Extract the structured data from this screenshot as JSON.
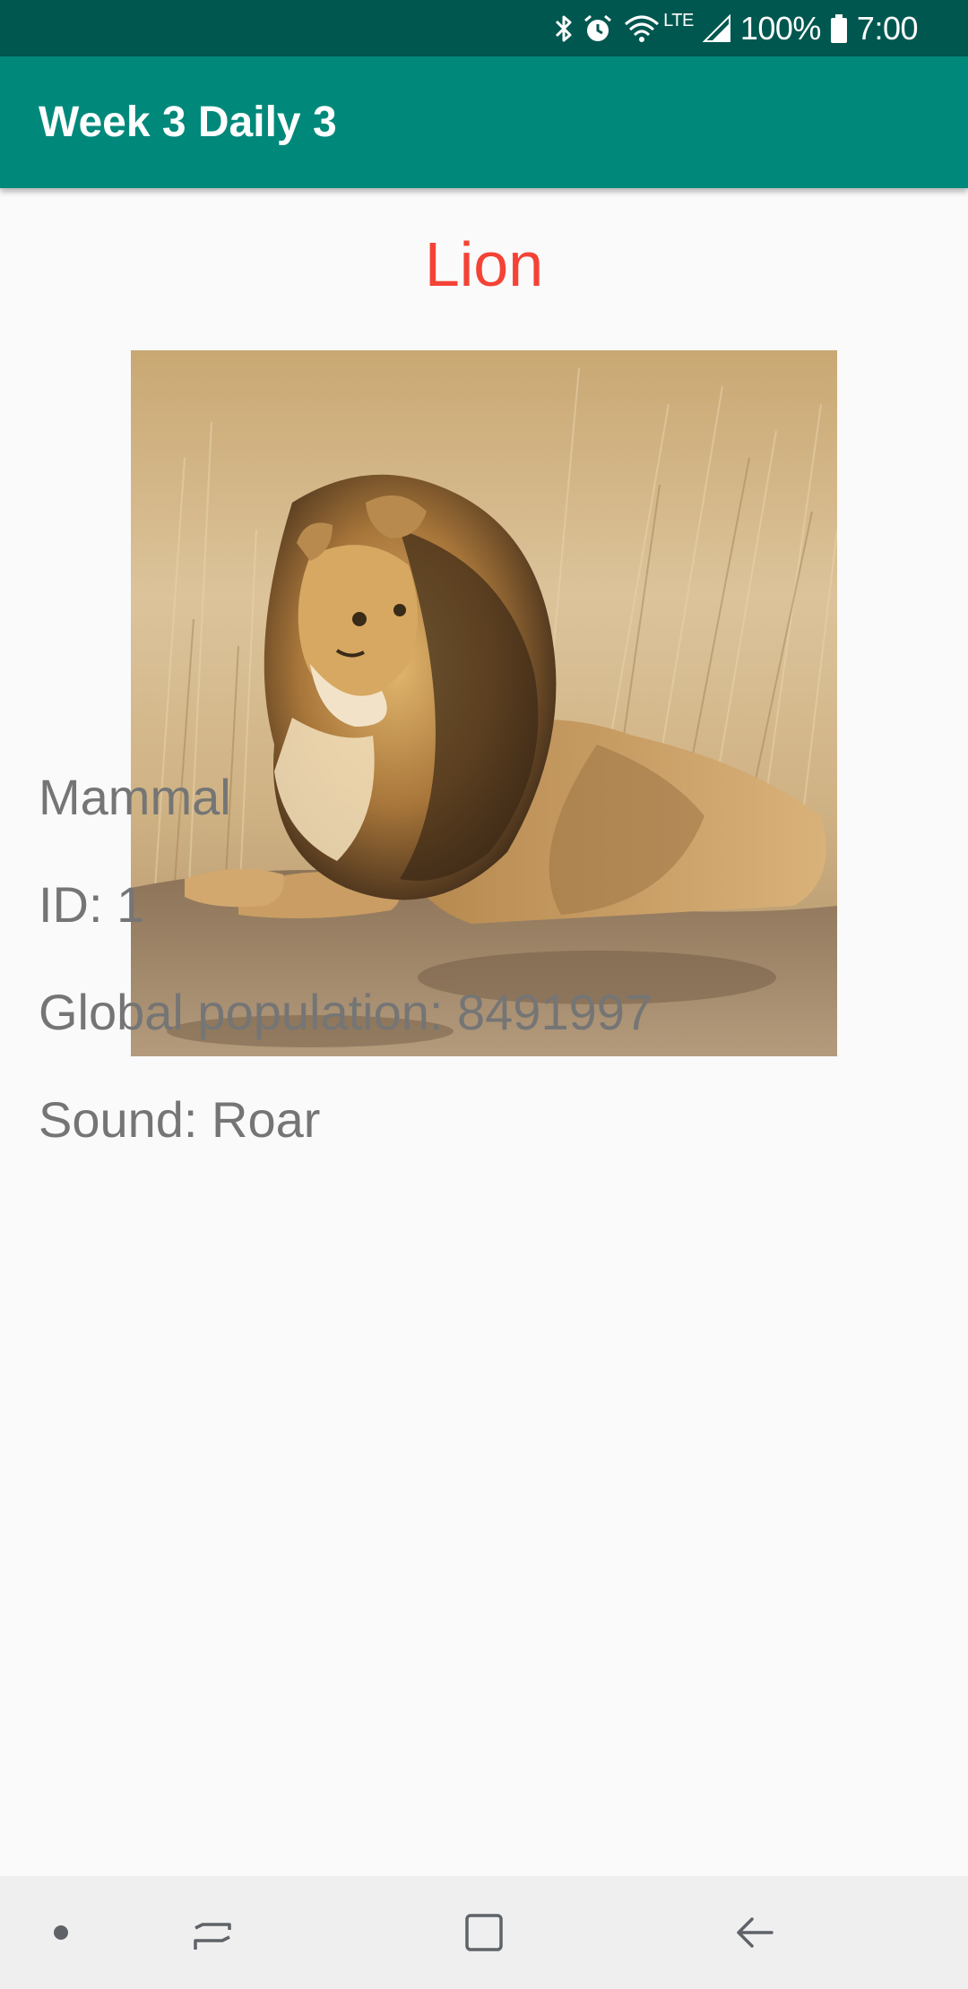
{
  "status_bar": {
    "battery": "100%",
    "time": "7:00",
    "network_label": "LTE",
    "icons": [
      "bluetooth-icon",
      "alarm-icon",
      "wifi-icon",
      "signal-icon",
      "battery-icon"
    ]
  },
  "app_bar": {
    "title": "Week 3 Daily 3"
  },
  "animal": {
    "name": "Lion",
    "image": "lion-photo",
    "class": "Mammal",
    "id_text": "ID: 1",
    "population_text": "Global population: 8491997",
    "sound_text": "Sound: Roar"
  },
  "nav_bar": {
    "buttons": [
      "dot-indicator",
      "recent-apps-icon",
      "home-icon",
      "back-icon"
    ]
  },
  "colors": {
    "status_bar": "#00574f",
    "app_bar": "#00897b",
    "title_accent": "#f44336",
    "detail_text": "#757575",
    "background": "#fafafa",
    "nav_bar": "#efefef"
  }
}
